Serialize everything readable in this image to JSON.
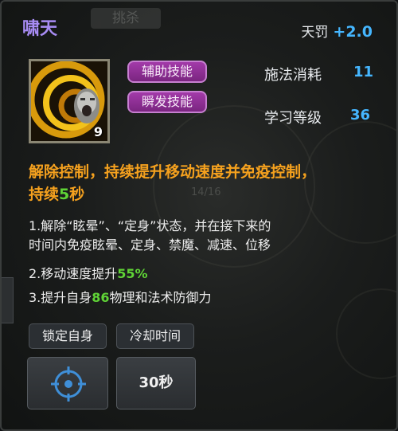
{
  "skill": {
    "name": "啸天",
    "icon": "roaring-vortex-skill-icon",
    "icon_level": "9",
    "penalty_label": "天罚",
    "penalty_value": "+2.0",
    "tags": [
      "辅助技能",
      "瞬发技能"
    ],
    "stats": [
      {
        "label": "施法消耗",
        "value": "11"
      },
      {
        "label": "学习等级",
        "value": "36"
      }
    ]
  },
  "description": {
    "line1": "解除控制，持续提升移动速度并免疫控制，",
    "line2_prefix": "持续",
    "line2_value": "5",
    "line2_suffix": "秒"
  },
  "details": {
    "item1_line1": "1.解除“眩晕”、“定身”状态，并在接下来的",
    "item1_line2": "时间内免疫眩晕、定身、禁魔、减速、位移",
    "item2_prefix": "2.移动速度提升",
    "item2_value": "55%",
    "item3_prefix": "3.提升自身",
    "item3_value": "86",
    "item3_suffix": "物理和法术防御力"
  },
  "footer": {
    "target_label": "锁定自身",
    "cooldown_label": "冷却时间",
    "target_icon": "crosshair-target-icon",
    "cooldown_value": "30秒"
  },
  "background": {
    "tab_label": "挑杀",
    "counter": "14/16"
  },
  "colors": {
    "title": "#a88cf4",
    "accent_blue": "#45b6ff",
    "description_orange": "#f5a11e",
    "highlight_green": "#5fd336",
    "tag_purple": "#a23aa9"
  }
}
